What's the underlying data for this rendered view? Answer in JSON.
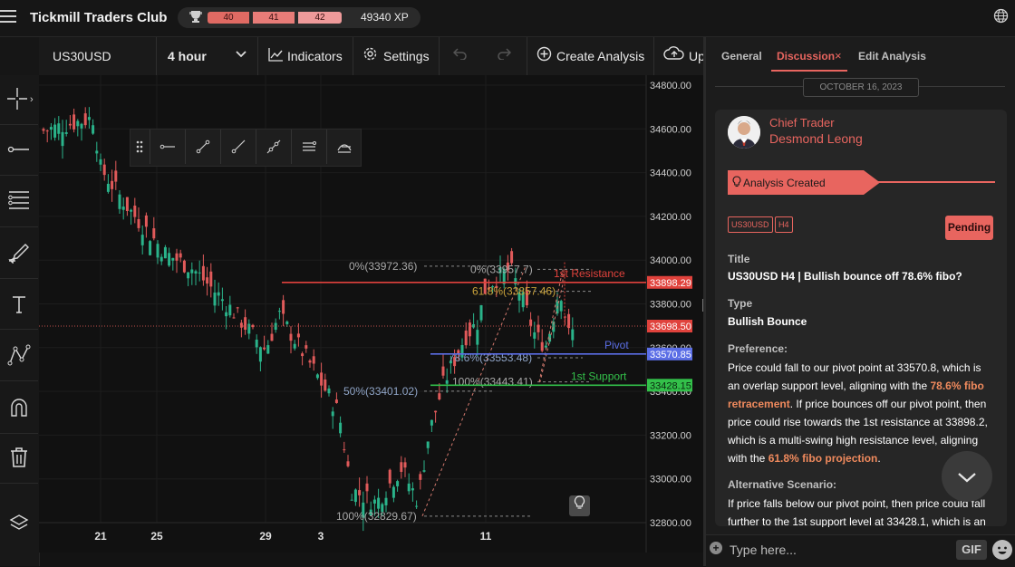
{
  "app": {
    "title": "Tickmill Traders Club",
    "xp": "49340 XP",
    "levels": [
      "40",
      "41",
      "42"
    ]
  },
  "toolbar": {
    "symbol": "US30USD",
    "interval": "4 hour",
    "indicators_label": "Indicators",
    "settings_label": "Settings",
    "create_analysis_label": "Create Analysis",
    "upload_label": "Upload"
  },
  "icons": {
    "menu": "hamburger-icon",
    "trophy": "trophy-icon",
    "globe": "globe-icon",
    "crosshair": "crosshair-icon",
    "horizontal_line": "horizontal-line-icon",
    "fib": "fibonacci-icon",
    "brush": "brush-icon",
    "text": "text-icon",
    "pattern": "pattern-icon",
    "magnet": "magnet-icon",
    "trash": "trash-icon",
    "layers": "layers-icon"
  },
  "chart_data": {
    "type": "candlestick",
    "symbol": "US30USD",
    "ylim": [
      32800,
      34800
    ],
    "y_ticks": [
      "34800.00",
      "34600.00",
      "34400.00",
      "34200.00",
      "34000.00",
      "33800.00",
      "33600.00",
      "33400.00",
      "33200.00",
      "33000.00",
      "32800.00"
    ],
    "x_ticks": [
      "21",
      "25",
      "29",
      "3",
      "11"
    ],
    "current_price": "33698.50",
    "levels": [
      {
        "label": "1st Resistance",
        "value": 33898.29,
        "price_label": "33898.29",
        "color": "#e0423c"
      },
      {
        "label": "Pivot",
        "value": 33570.85,
        "price_label": "33570.85",
        "color": "#5b6ee6"
      },
      {
        "label": "1st Support",
        "value": 33428.15,
        "price_label": "33428.15",
        "color": "#33c04a"
      }
    ],
    "fib_labels_left": [
      {
        "text": "0%(33972.36)",
        "value": 33972.36
      },
      {
        "text": "50%(33401.02)",
        "value": 33401.02
      },
      {
        "text": "100%(32829.67)",
        "value": 32829.67
      }
    ],
    "fib_labels_right": [
      {
        "text": "0%(33957.7)",
        "value": 33957.7
      },
      {
        "text": "61.8%(33857.46)",
        "value": 33857.46
      },
      {
        "text": "78.6%(33553.48)",
        "value": 33553.48
      },
      {
        "text": "100%(33443.41)",
        "value": 33443.41
      }
    ]
  },
  "panel": {
    "tabs": {
      "general": "General",
      "discussion": "Discussion",
      "edit": "Edit Analysis"
    },
    "date": "OCTOBER 16, 2023",
    "role": "Chief Trader",
    "author": "Desmond Leong",
    "event": "Analysis Created",
    "tags": [
      "US30USD",
      "H4"
    ],
    "status": "Pending",
    "title_heading": "Title",
    "title": "US30USD H4 | Bullish bounce off 78.6% fibo?",
    "type_heading": "Type",
    "type": "Bullish Bounce",
    "preference_heading": "Preference:",
    "preference_parts": [
      "Price could fall to our pivot point at 33570.8, which is an overlap support level, aligning with the ",
      "78.6% fibo retracement",
      ". If price bounces off our pivot point, then price could rise towards the 1st resistance at 33898.2, which is a multi-swing high resistance level, aligning with the ",
      "61.8% fibo projection",
      "."
    ],
    "alternative_heading": "Alternative Scenario:",
    "alternative": "If price falls below our pivot point, then price could fall further to the 1st support level at 33428.1, which is an",
    "composer_placeholder": "Type here...",
    "gif_label": "GIF"
  }
}
